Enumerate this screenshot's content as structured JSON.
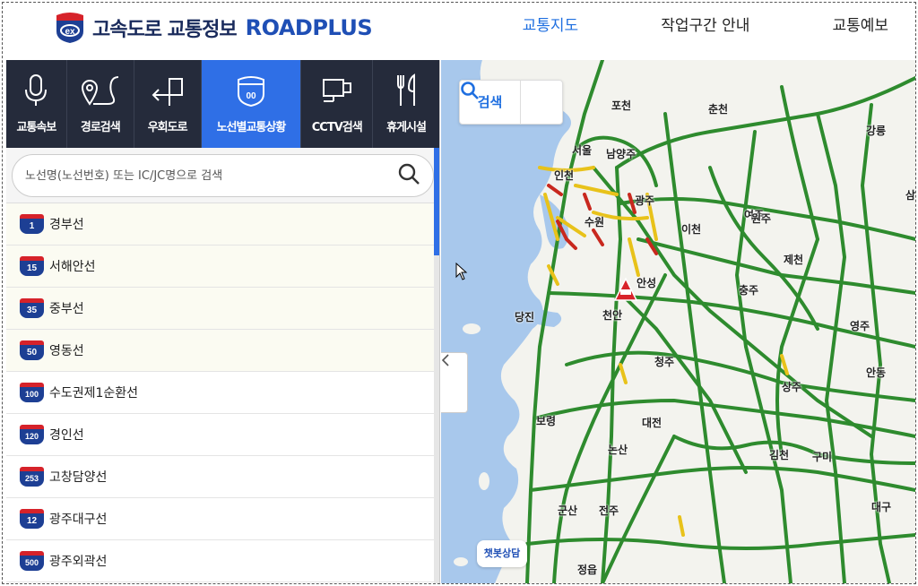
{
  "header": {
    "logo_ko": "고속도로 교통정보",
    "logo_en": "ROADPLUS",
    "logo_badge": "ex",
    "nav": [
      {
        "label": "교통지도",
        "active": true
      },
      {
        "label": "작업구간 안내",
        "active": false
      },
      {
        "label": "교통예보",
        "active": false
      }
    ]
  },
  "tabs": [
    {
      "label": "교통속보",
      "icon": "microphone-icon"
    },
    {
      "label": "경로검색",
      "icon": "route-icon"
    },
    {
      "label": "우회도로",
      "icon": "detour-icon"
    },
    {
      "label": "노선별교통상황",
      "icon": "highway-shield-icon",
      "active": true,
      "badge": "00"
    },
    {
      "label": "CCTV검색",
      "icon": "cctv-icon"
    },
    {
      "label": "휴게시설",
      "icon": "fork-knife-icon"
    }
  ],
  "search": {
    "placeholder": "노선명(노선번호) 또는 IC/JC명으로 검색"
  },
  "routes": [
    {
      "number": "1",
      "name": "경부선"
    },
    {
      "number": "15",
      "name": "서해안선"
    },
    {
      "number": "35",
      "name": "중부선"
    },
    {
      "number": "50",
      "name": "영동선"
    },
    {
      "number": "100",
      "name": "수도권제1순환선"
    },
    {
      "number": "120",
      "name": "경인선"
    },
    {
      "number": "253",
      "name": "고창담양선"
    },
    {
      "number": "12",
      "name": "광주대구선"
    },
    {
      "number": "500",
      "name": "광주외곽선"
    }
  ],
  "map": {
    "search_label": "검색",
    "chatbot_label": "챗봇상담",
    "cities": [
      "포천",
      "춘천",
      "강릉",
      "서울",
      "남양주",
      "인천",
      "광주",
      "수원",
      "여주",
      "이천",
      "원주",
      "안성",
      "제천",
      "충주",
      "당진",
      "천안",
      "영주",
      "청주",
      "안동",
      "상주",
      "보령",
      "대전",
      "논산",
      "김천",
      "구미",
      "군산",
      "전주",
      "정읍",
      "대구",
      "삼"
    ]
  },
  "colors": {
    "accent": "#2f6fe6",
    "tab_bg": "#252b3b",
    "road_green": "#2e8b2e",
    "road_yellow": "#e8c21a",
    "road_red": "#c8281e",
    "sea": "#a8c8ec",
    "land": "#f3f3ee"
  }
}
